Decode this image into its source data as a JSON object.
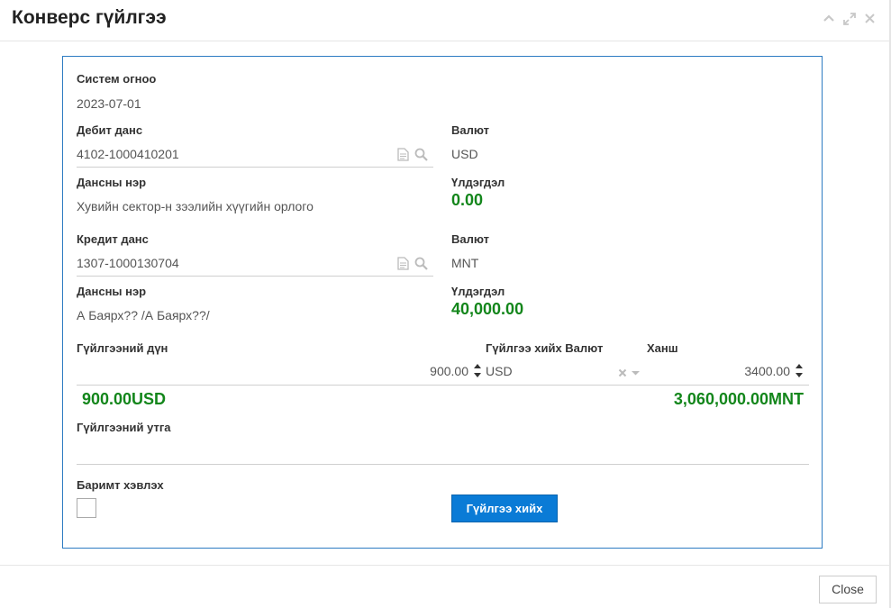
{
  "dialog": {
    "title": "Конверс гүйлгээ"
  },
  "form": {
    "system_date_label": "Систем огноо",
    "system_date_value": "2023-07-01",
    "debit": {
      "account_label": "Дебит данс",
      "account_value": "4102-1000410201",
      "currency_label": "Валют",
      "currency_value": "USD",
      "name_label": "Дансны нэр",
      "name_value": "Хувийн сектор-н зээлийн хүүгийн орлого",
      "balance_label": "Үлдэгдэл",
      "balance_value": "0.00"
    },
    "credit": {
      "account_label": "Кредит данс",
      "account_value": "1307-1000130704",
      "currency_label": "Валют",
      "currency_value": "MNT",
      "name_label": "Дансны нэр",
      "name_value": "А Баярх?? /А Баярх??/",
      "balance_label": "Үлдэгдэл",
      "balance_value": "40,000.00"
    },
    "amount_label": "Гүйлгээний дүн",
    "amount_value": "900.00",
    "txn_currency_label": "Гүйлгээ хийх Валют",
    "txn_currency_value": "USD",
    "rate_label": "Ханш",
    "rate_value": "3400.00",
    "summary_left": "900.00USD",
    "summary_right": "3,060,000.00MNT",
    "purpose_label": "Гүйлгээний утга",
    "purpose_value": "",
    "print_receipt_label": "Баримт хэвлэх",
    "print_receipt_checked": false,
    "submit_label": "Гүйлгээ хийх"
  },
  "footer": {
    "close_label": "Close"
  },
  "colors": {
    "accent": "#0a7bd6",
    "panel_border": "#2d7bc2",
    "money_green": "#13861b"
  },
  "icons": {
    "header": [
      "chevron-up-icon",
      "expand-icon",
      "close-icon"
    ],
    "field": [
      "document-icon",
      "search-icon"
    ],
    "select": [
      "clear-icon",
      "caret-down-icon"
    ]
  }
}
